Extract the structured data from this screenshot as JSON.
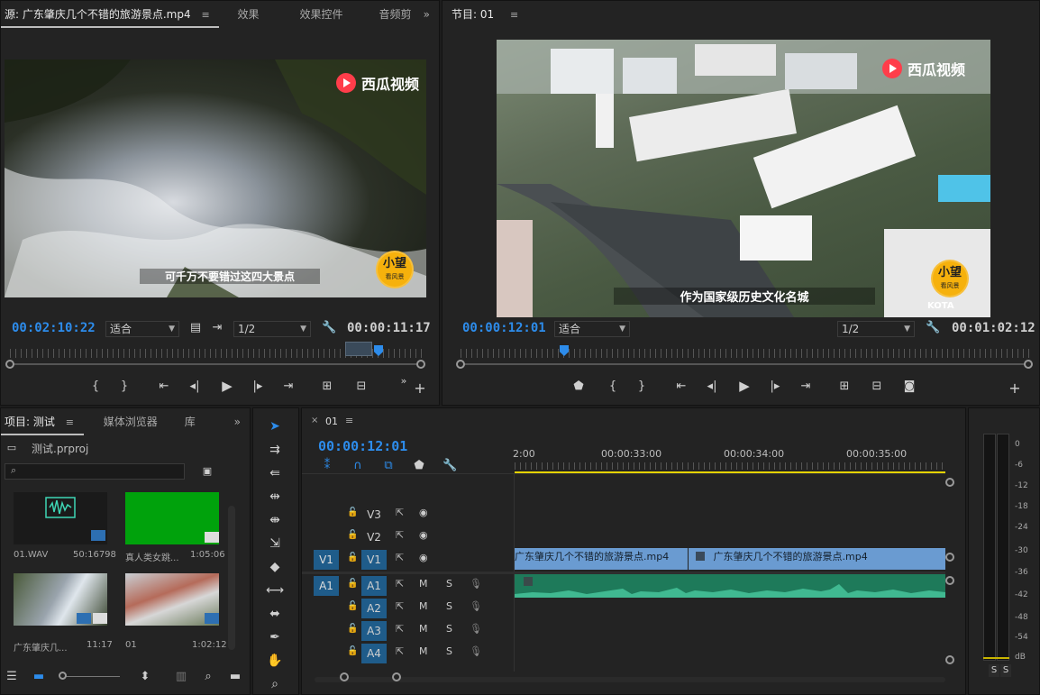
{
  "source_monitor": {
    "tabs": [
      "源: 广东肇庆几个不错的旅游景点.mp4",
      "效果",
      "效果控件",
      "音频剪"
    ],
    "menu_icon": "menu-icon",
    "overflow_icon": "double-chevron-right-icon",
    "current_time": "00:02:10:22",
    "duration": "00:00:11:17",
    "fit": "适合",
    "resolution": "1/2",
    "subtitle": "可千万不要错过这四大景点",
    "watermark": "西瓜视频",
    "badge_main": "小望",
    "badge_small": "看风景"
  },
  "program_monitor": {
    "title": "节目: 01",
    "current_time": "00:00:12:01",
    "duration": "00:01:02:12",
    "fit": "适合",
    "resolution": "1/2",
    "subtitle": "作为国家级历史文化名城",
    "watermark": "西瓜视频",
    "badge_main": "小望",
    "badge_small": "看风景",
    "corner_text": "KOTA"
  },
  "project": {
    "tabs": [
      "项目: 测试",
      "媒体浏览器",
      "库"
    ],
    "project_file": "测试.prproj",
    "items": [
      {
        "name": "01.WAV",
        "duration": "50:16798"
      },
      {
        "name": "真人类女跳...",
        "duration": "1:05:06"
      },
      {
        "name": "广东肇庆几...",
        "duration": "11:17"
      },
      {
        "name": "01",
        "duration": "1:02:12"
      }
    ]
  },
  "timeline": {
    "sequence": "01",
    "current_time": "00:00:12:01",
    "ruler_labels": [
      "2:00",
      "00:00:33:00",
      "00:00:34:00",
      "00:00:35:00"
    ],
    "tracks": [
      {
        "src": "",
        "name": "V3",
        "type": "video"
      },
      {
        "src": "",
        "name": "V2",
        "type": "video"
      },
      {
        "src": "V1",
        "name": "V1",
        "type": "video"
      },
      {
        "src": "A1",
        "name": "A1",
        "type": "audio"
      },
      {
        "src": "",
        "name": "A2",
        "type": "audio"
      },
      {
        "src": "",
        "name": "A3",
        "type": "audio"
      },
      {
        "src": "",
        "name": "A4",
        "type": "audio"
      }
    ],
    "m_label": "M",
    "s_label": "S",
    "clip1": "广东肇庆几个不错的旅游景点.mp4",
    "clip2": "广东肇庆几个不错的旅游景点.mp4"
  },
  "audio_meter": {
    "labels": [
      "0",
      "-6",
      "-12",
      "-18",
      "-24",
      "-30",
      "-36",
      "-42",
      "-48",
      "-54",
      "dB"
    ],
    "solo": [
      "S",
      "S"
    ]
  },
  "colors": {
    "accent": "#2d8ceb",
    "video_clip": "#6a9bd1",
    "audio_clip": "#1e7a5a"
  }
}
